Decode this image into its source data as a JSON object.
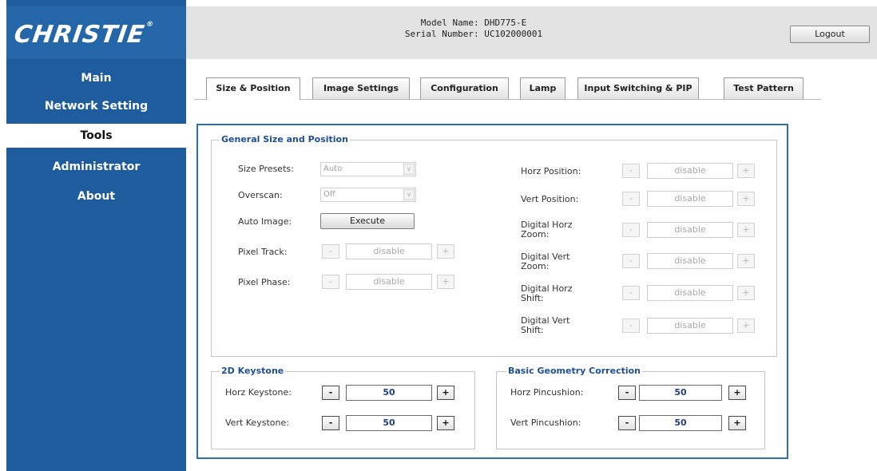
{
  "brand": {
    "logo_text": "CHRISTIE",
    "logo_mark": "®"
  },
  "sidebar": {
    "items": [
      {
        "label": "Main",
        "active": false
      },
      {
        "label": "Network Setting",
        "active": false
      },
      {
        "label": "Tools",
        "active": true
      },
      {
        "label": "Administrator",
        "active": false
      },
      {
        "label": "About",
        "active": false
      }
    ]
  },
  "header": {
    "model_line": "Model Name: DHD775-E",
    "serial_line": "Serial Number: UC102000001",
    "logout_label": "Logout"
  },
  "tabs": [
    {
      "label": "Size & Position",
      "active": true
    },
    {
      "label": "Image Settings",
      "active": false
    },
    {
      "label": "Configuration",
      "active": false
    },
    {
      "label": "Lamp",
      "active": false
    },
    {
      "label": "Input Switching & PIP",
      "active": false
    },
    {
      "label": "Test Pattern",
      "active": false
    }
  ],
  "general": {
    "legend": "General Size and Position",
    "size_presets": {
      "label": "Size Presets:",
      "value": "Auto"
    },
    "overscan": {
      "label": "Overscan:",
      "value": "Off"
    },
    "auto_image": {
      "label": "Auto Image:",
      "button": "Execute"
    },
    "pixel_track": {
      "label": "Pixel Track:",
      "value": "disable"
    },
    "pixel_phase": {
      "label": "Pixel Phase:",
      "value": "disable"
    },
    "horz_position": {
      "label": "Horz Position:",
      "value": "disable"
    },
    "vert_position": {
      "label": "Vert Position:",
      "value": "disable"
    },
    "digital_horz_zoom": {
      "label_line1": "Digital Horz",
      "label_line2": "Zoom:",
      "value": "disable"
    },
    "digital_vert_zoom": {
      "label_line1": "Digital Vert",
      "label_line2": "Zoom:",
      "value": "disable"
    },
    "digital_horz_shift": {
      "label_line1": "Digital Horz",
      "label_line2": "Shift:",
      "value": "disable"
    },
    "digital_vert_shift": {
      "label_line1": "Digital Vert",
      "label_line2": "Shift:",
      "value": "disable"
    }
  },
  "keystone": {
    "legend": "2D Keystone",
    "horz": {
      "label": "Horz Keystone:",
      "value": "50"
    },
    "vert": {
      "label": "Vert Keystone:",
      "value": "50"
    }
  },
  "geometry": {
    "legend": "Basic Geometry Correction",
    "horz": {
      "label": "Horz Pincushion:",
      "value": "50"
    },
    "vert": {
      "label": "Vert Pincushion:",
      "value": "50"
    }
  },
  "stepper": {
    "minus": "-",
    "plus": "+"
  },
  "select_arrow": "∨",
  "colors": {
    "sidebar": "#1e5c9e",
    "accent": "#2d6fb2",
    "legend": "#1f4f8f"
  }
}
